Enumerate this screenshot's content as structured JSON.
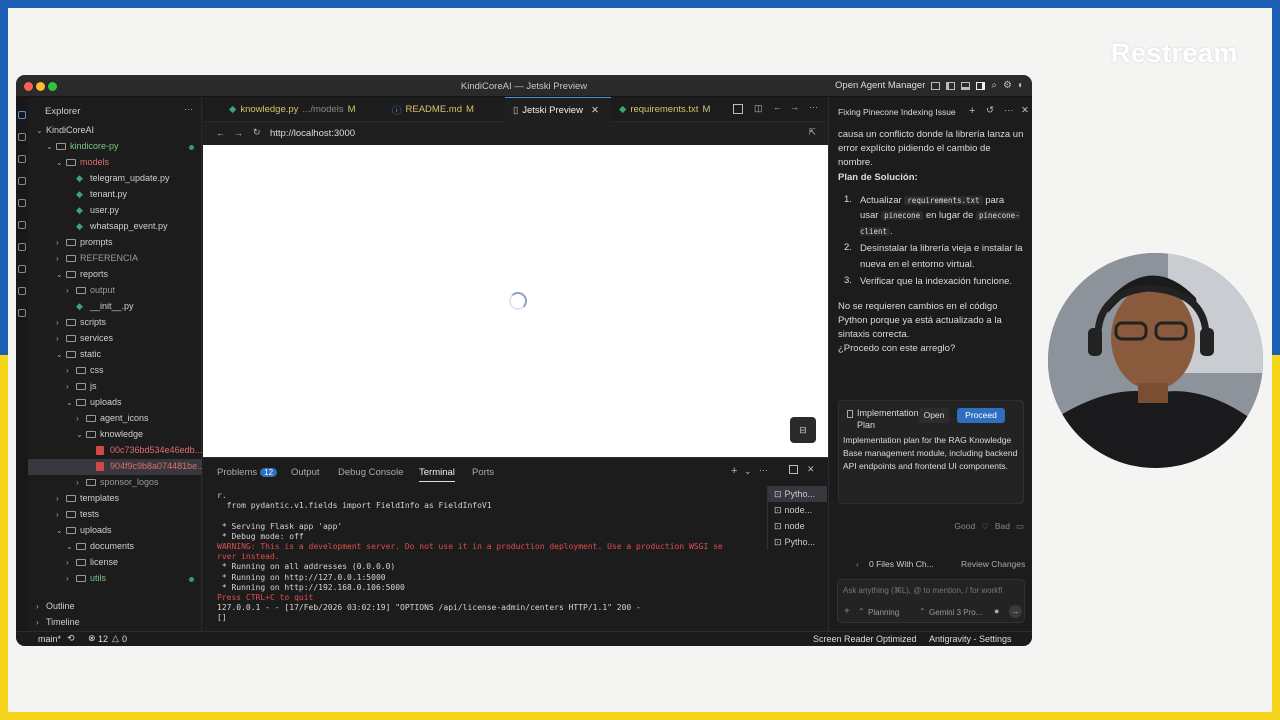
{
  "overlay": {
    "brand": "Restream"
  },
  "window": {
    "title": "KindiCoreAI — Jetski Preview",
    "agent_manager": "Open Agent Manager"
  },
  "explorer": {
    "header": "Explorer",
    "root": "KindiCoreAI",
    "rows": [
      {
        "label": "kindicore-py",
        "indent": 1,
        "kind": "folder",
        "open": true,
        "color": "#79c785",
        "dot": true
      },
      {
        "label": "models",
        "indent": 2,
        "kind": "folder",
        "open": true,
        "color": "#e06c6c",
        "sel": false
      },
      {
        "label": "telegram_update.py",
        "indent": 3,
        "kind": "py"
      },
      {
        "label": "tenant.py",
        "indent": 3,
        "kind": "py"
      },
      {
        "label": "user.py",
        "indent": 3,
        "kind": "py"
      },
      {
        "label": "whatsapp_event.py",
        "indent": 3,
        "kind": "py"
      },
      {
        "label": "prompts",
        "indent": 2,
        "kind": "folder",
        "open": false
      },
      {
        "label": "REFERENCIA",
        "indent": 2,
        "kind": "folder",
        "open": false,
        "color": "#9a9a9a"
      },
      {
        "label": "reports",
        "indent": 2,
        "kind": "folder",
        "open": true
      },
      {
        "label": "output",
        "indent": 3,
        "kind": "folder",
        "open": false,
        "color": "#9a9a9a"
      },
      {
        "label": "__init__.py",
        "indent": 3,
        "kind": "py"
      },
      {
        "label": "scripts",
        "indent": 2,
        "kind": "folder",
        "open": false
      },
      {
        "label": "services",
        "indent": 2,
        "kind": "folder",
        "open": false
      },
      {
        "label": "static",
        "indent": 2,
        "kind": "folder",
        "open": true
      },
      {
        "label": "css",
        "indent": 3,
        "kind": "folder",
        "open": false
      },
      {
        "label": "js",
        "indent": 3,
        "kind": "folder",
        "open": false
      },
      {
        "label": "uploads",
        "indent": 3,
        "kind": "folder",
        "open": true
      },
      {
        "label": "agent_icons",
        "indent": 4,
        "kind": "folder",
        "open": false
      },
      {
        "label": "knowledge",
        "indent": 4,
        "kind": "folder",
        "open": true
      },
      {
        "label": "00c736bd534e46edb...",
        "indent": 5,
        "kind": "pdf",
        "color": "#e06c6c"
      },
      {
        "label": "904f9c9b8a074481be...",
        "indent": 5,
        "kind": "pdf",
        "color": "#e06c6c",
        "sel": true
      },
      {
        "label": "sponsor_logos",
        "indent": 4,
        "kind": "folder",
        "open": false,
        "color": "#9a9a9a"
      },
      {
        "label": "templates",
        "indent": 2,
        "kind": "folder",
        "open": false
      },
      {
        "label": "tests",
        "indent": 2,
        "kind": "folder",
        "open": false
      },
      {
        "label": "uploads",
        "indent": 2,
        "kind": "folder",
        "open": true
      },
      {
        "label": "documents",
        "indent": 3,
        "kind": "folder",
        "open": true
      },
      {
        "label": "license",
        "indent": 3,
        "kind": "folder",
        "open": false
      },
      {
        "label": "utils",
        "indent": 3,
        "kind": "folder",
        "open": false,
        "color": "#79c785",
        "dot": true
      }
    ],
    "outline": "Outline",
    "timeline": "Timeline"
  },
  "tabs": [
    {
      "label": "knowledge.py",
      "sub": ".../models",
      "flag": "M",
      "icon": "py"
    },
    {
      "label": "README.md",
      "flag": "M",
      "icon": "md"
    },
    {
      "label": "Jetski Preview",
      "flag": "",
      "icon": "doc",
      "active": true
    },
    {
      "label": "requirements.txt",
      "flag": "M",
      "icon": "py"
    }
  ],
  "preview": {
    "url": "http://localhost:3000",
    "fab": "⊟"
  },
  "panel": {
    "tabs": [
      {
        "label": "Problems",
        "badge": "12"
      },
      {
        "label": "Output"
      },
      {
        "label": "Debug Console"
      },
      {
        "label": "Terminal",
        "active": true
      },
      {
        "label": "Ports"
      }
    ],
    "terminal_lines": [
      {
        "text": "r."
      },
      {
        "text": "  from pydantic.v1.fields import FieldInfo as FieldInfoV1"
      },
      {
        "text": ""
      },
      {
        "text": " * Serving Flask app 'app'"
      },
      {
        "text": " * Debug mode: off"
      },
      {
        "text": "WARNING: This is a development server. Do not use it in a production deployment. Use a production WSGI se",
        "red": true
      },
      {
        "text": "rver instead.",
        "red": true
      },
      {
        "text": " * Running on all addresses (0.0.0.0)"
      },
      {
        "text": " * Running on http://127.0.0.1:5000"
      },
      {
        "text": " * Running on http://192.168.0.106:5000"
      },
      {
        "text": "Press CTRL+C to quit",
        "red": true
      },
      {
        "text": "127.0.0.1 - - [17/Feb/2026 03:02:19] \"OPTIONS /api/license-admin/centers HTTP/1.1\" 200 -"
      },
      {
        "text": "[]"
      }
    ],
    "terminals": [
      "Pytho...",
      "node...",
      "node",
      "Pytho..."
    ]
  },
  "chat": {
    "title": "Fixing Pinecone Indexing Issue",
    "intro": "causa un conflicto donde la librería lanza un error explícito pidiendo el cambio de nombre.",
    "plan_heading": "Plan de Solución:",
    "step1_a": "Actualizar",
    "step1_code1": "requirements.txt",
    "step1_b": "para usar",
    "step1_code2": "pinecone",
    "step1_c": "en lugar de",
    "step1_code3": "pinecone-client",
    "step1_d": ".",
    "step2": "Desinstalar la librería vieja e instalar la nueva en el entorno virtual.",
    "step3": "Verificar que la indexación funcione.",
    "note": "No se requieren cambios en el código Python porque ya está actualizado a la sintaxis correcta.",
    "question": "¿Procedo con este arreglo?",
    "card_title": "Implementation Plan",
    "open_label": "Open",
    "proceed_label": "Proceed",
    "card_desc": "Implementation plan for the RAG Knowledge Base management module, including backend API endpoints and frontend UI components.",
    "good": "Good",
    "bad": "Bad",
    "files_changed": "0 Files With Ch...",
    "review": "Review Changes",
    "input_placeholder": "Ask anything (⌘L), @ to mention, / for workfl",
    "mode": "Planning",
    "model": "Gemini 3 Pro..."
  },
  "status": {
    "branch": "main*",
    "errors": "12",
    "warnings": "0",
    "screen_reader": "Screen Reader Optimized",
    "settings": "Antigravity - Settings"
  }
}
